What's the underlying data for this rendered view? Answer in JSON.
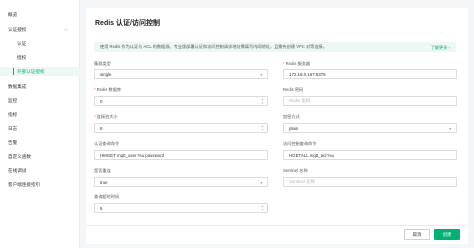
{
  "sidebar": {
    "items": [
      {
        "label": "概览"
      },
      {
        "label": "认证授权"
      },
      {
        "label": "认证"
      },
      {
        "label": "授权"
      },
      {
        "label": "外部认证授权"
      },
      {
        "label": "数据集成"
      },
      {
        "label": "监控"
      },
      {
        "label": "指标"
      },
      {
        "label": "日志"
      },
      {
        "label": "告警"
      },
      {
        "label": "自定义函数"
      },
      {
        "label": "在线调试"
      },
      {
        "label": "客户端连接指引"
      }
    ],
    "chevron": "chevron-up-icon"
  },
  "page": {
    "title": "Redis 认证/访问控制",
    "tip": "使用 Redis 作为认证与 ACL 的数据源。专业版部署认证和访问控制请求地址需填写内网地址，且需先创建 VPC 对等连接。",
    "tip_link": "了解更多"
  },
  "form": {
    "deploy_mode": {
      "label": "集群类型",
      "value": "single",
      "required": false
    },
    "server": {
      "label": "Redis 服务器",
      "value": "172.18.0.167:6379",
      "required": true
    },
    "database": {
      "label": "Redis 数据库",
      "value": "0",
      "required": true
    },
    "password": {
      "label": "Redis 密码",
      "placeholder": "Redis 密码",
      "required": false
    },
    "pool_size": {
      "label": "连接池大小",
      "value": "8",
      "required": true
    },
    "password_hash": {
      "label": "加密方式",
      "value": "plain",
      "required": false
    },
    "auth_cmd": {
      "label": "认证查询命令",
      "value": "HMGET mqtt_user:%u password",
      "required": false
    },
    "acl_cmd": {
      "label": "访问控制查询命令",
      "value": "HGETALL mqtt_acl:%u",
      "required": false
    },
    "auto_reconnect": {
      "label": "是否重连",
      "value": "true",
      "required": false
    },
    "sentinel": {
      "label": "Sentinel 名称",
      "placeholder": "Sentinel 名称",
      "required": false
    },
    "query_timeout": {
      "label": "查询超时时间",
      "value": "5",
      "required": false
    }
  },
  "actions": {
    "cancel": "取消",
    "create": "创建"
  },
  "colors": {
    "accent": "#00b173",
    "required": "#e34d59"
  }
}
